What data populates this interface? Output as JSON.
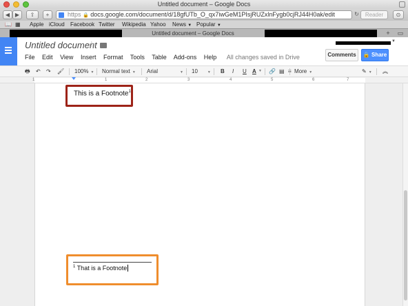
{
  "browser": {
    "window_title": "Untitled document – Google Docs",
    "url_prefix": "https",
    "url": "docs.google.com/document/d/18gfUTb_O_qx7iwGeM1PIsjRUZxlnFygb0cjRJ44H0ak/edit",
    "reader_label": "Reader",
    "active_tab_label": "Untitled document – Google Docs",
    "bookmarks": [
      "Apple",
      "iCloud",
      "Facebook",
      "Twitter",
      "Wikipedia",
      "Yahoo",
      "News",
      "Popular"
    ],
    "new_tab_label": "+"
  },
  "docs": {
    "title": "Untitled document",
    "menu": [
      "File",
      "Edit",
      "View",
      "Insert",
      "Format",
      "Tools",
      "Table",
      "Add-ons",
      "Help"
    ],
    "save_status": "All changes saved in Drive",
    "comments_label": "Comments",
    "share_label": "Share",
    "accent_color": "#4285f4"
  },
  "formatting": {
    "zoom": "100%",
    "style": "Normal text",
    "font": "Arial",
    "size": "10",
    "bold": "B",
    "italic": "I",
    "underline": "U",
    "text_color": "A",
    "more": "More"
  },
  "ruler": {
    "ticks": [
      "1",
      "1",
      "2",
      "3",
      "4",
      "5",
      "6",
      "7"
    ]
  },
  "document": {
    "body_text": "This is a Footnote",
    "body_sup": "1",
    "body_end": ".",
    "footnote_number": "1",
    "footnote_text": "That is a Footnote",
    "annotation_colors": {
      "body": "#9d2318",
      "footnote": "#ef8d2d"
    }
  }
}
